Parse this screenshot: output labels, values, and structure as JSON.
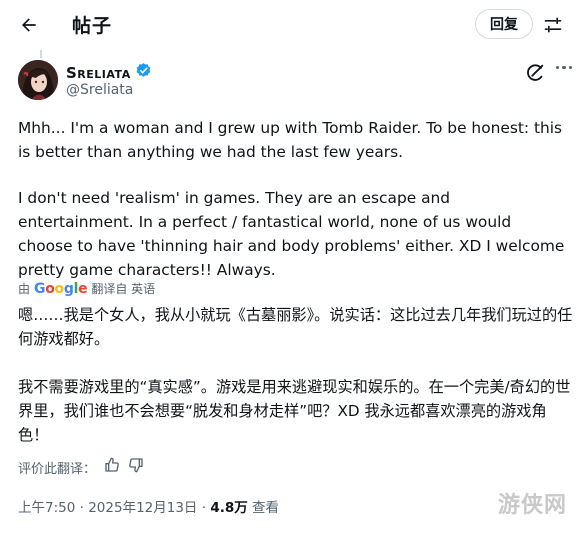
{
  "header": {
    "title": "帖子",
    "reply_label": "回复"
  },
  "author": {
    "name": "Sreliata",
    "handle": "@Sreliata"
  },
  "tweet": {
    "para1": "Mhh... I'm a woman and I grew up with Tomb Raider. To be honest: this is better than anything we had the last few years.",
    "para2": "I don't need 'realism' in games. They are an escape and entertainment. In a perfect / fantastical world, none of us would choose to have 'thinning hair and body problems' either. XD I welcome pretty game characters!! Always."
  },
  "translation": {
    "by": "由",
    "google": "Google",
    "from_label": "翻译自 英语",
    "para1": "嗯……我是个女人，我从小就玩《古墓丽影》。说实话：这比过去几年我们玩过的任何游戏都好。",
    "para2": "我不需要游戏里的“真实感”。游戏是用来逃避现实和娱乐的。在一个完美/奇幻的世界里，我们谁也不会想要“脱发和身材走样”吧？XD 我永远都喜欢漂亮的游戏角色！",
    "rate_label": "评价此翻译："
  },
  "meta": {
    "time": "上午7:50",
    "sep": "·",
    "date": "2025年12月13日",
    "views": "4.8万",
    "views_label": "查看"
  },
  "watermark": "游侠网",
  "colors": {
    "verified": "#1d9bf0",
    "muted": "#536471",
    "border": "#cfd9de"
  },
  "icons": [
    "back-arrow-icon",
    "adjust-icon",
    "verified-badge-icon",
    "grok-icon",
    "more-icon",
    "thumbs-up-icon",
    "thumbs-down-icon"
  ]
}
